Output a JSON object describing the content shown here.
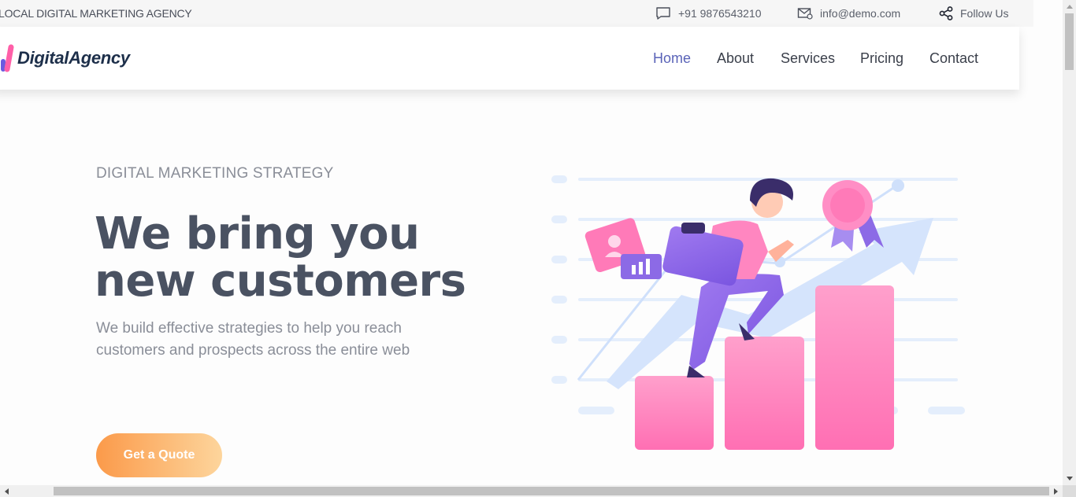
{
  "topbar": {
    "agency": "LOCAL DIGITAL MARKETING AGENCY",
    "phone": "+91 9876543210",
    "email": "info@demo.com",
    "follow": "Follow Us",
    "icons": {
      "phone": "chat-bubble-icon",
      "email": "envelope-icon",
      "follow": "share-icon"
    }
  },
  "header": {
    "logo_text": "DigitalAgency",
    "nav": [
      "Home",
      "About",
      "Services",
      "Pricing",
      "Contact"
    ],
    "active_nav": "Home"
  },
  "hero": {
    "eyebrow": "DIGITAL MARKETING STRATEGY",
    "headline_line1": "We bring you",
    "headline_line2": "new customers",
    "subtext": "We build effective strategies to help you reach customers and prospects across the entire web",
    "cta": "Get a Quote",
    "illustration": "person-climbing-bar-chart-illustration"
  },
  "colors": {
    "accent": "#5a63b8",
    "headline": "#4a5262",
    "muted_text": "#8a8e98",
    "cta_start": "#fb9a4a",
    "cta_end": "#fdd59c",
    "pink": "#ff86c0",
    "purple": "#8c6ae6"
  }
}
